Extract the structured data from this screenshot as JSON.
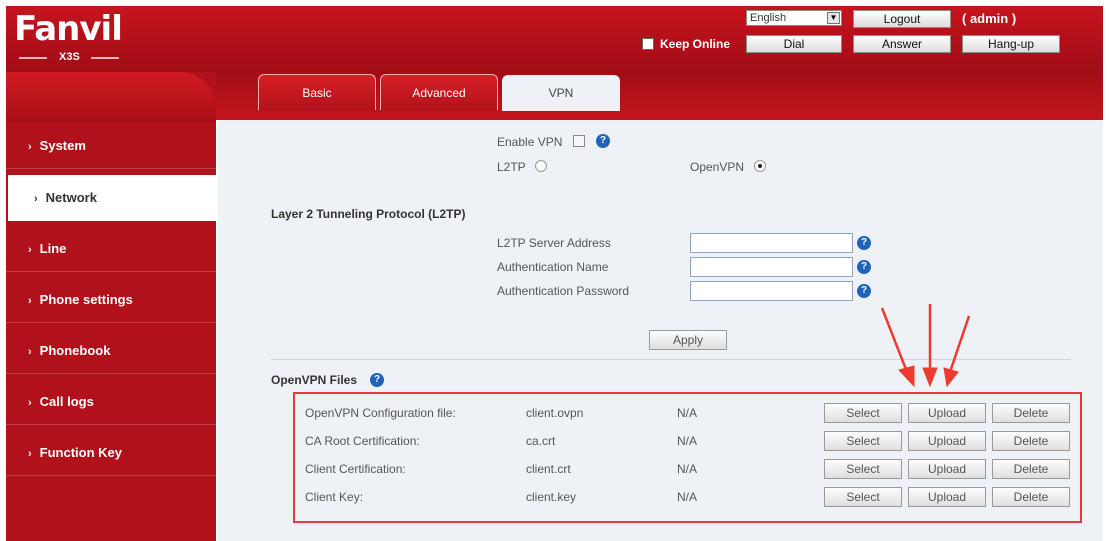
{
  "brand": {
    "logo": "Fanvil",
    "model": "X3S"
  },
  "header": {
    "language": "English",
    "logout_label": "Logout",
    "user": "( admin )",
    "keep_online_label": "Keep Online",
    "dial_label": "Dial",
    "answer_label": "Answer",
    "hangup_label": "Hang-up"
  },
  "sidebar": {
    "items": [
      {
        "label": "System",
        "active": false
      },
      {
        "label": "Network",
        "active": true
      },
      {
        "label": "Line",
        "active": false
      },
      {
        "label": "Phone settings",
        "active": false
      },
      {
        "label": "Phonebook",
        "active": false
      },
      {
        "label": "Call logs",
        "active": false
      },
      {
        "label": "Function Key",
        "active": false
      }
    ]
  },
  "tabs": [
    {
      "label": "Basic",
      "active": false
    },
    {
      "label": "Advanced",
      "active": false
    },
    {
      "label": "VPN",
      "active": true
    }
  ],
  "vpn": {
    "enable_label": "Enable VPN",
    "enabled": false,
    "l2tp_label": "L2TP",
    "openvpn_label": "OpenVPN",
    "selected_mode": "OpenVPN"
  },
  "l2tp": {
    "title": "Layer 2 Tunneling Protocol (L2TP)",
    "server_label": "L2TP Server Address",
    "server_value": "",
    "auth_name_label": "Authentication Name",
    "auth_name_value": "",
    "auth_password_label": "Authentication Password",
    "auth_password_value": "",
    "apply_label": "Apply"
  },
  "openvpn_files": {
    "title": "OpenVPN Files",
    "select_label": "Select",
    "upload_label": "Upload",
    "delete_label": "Delete",
    "rows": [
      {
        "label": "OpenVPN Configuration file:",
        "file": "client.ovpn",
        "status": "N/A"
      },
      {
        "label": "CA Root Certification:",
        "file": "ca.crt",
        "status": "N/A"
      },
      {
        "label": "Client Certification:",
        "file": "client.crt",
        "status": "N/A"
      },
      {
        "label": "Client Key:",
        "file": "client.key",
        "status": "N/A"
      }
    ]
  },
  "colors": {
    "brand_red": "#b1101a",
    "content_bg": "#eef2f6",
    "highlight_red": "#e53a3a",
    "help_blue": "#1f64b8"
  }
}
